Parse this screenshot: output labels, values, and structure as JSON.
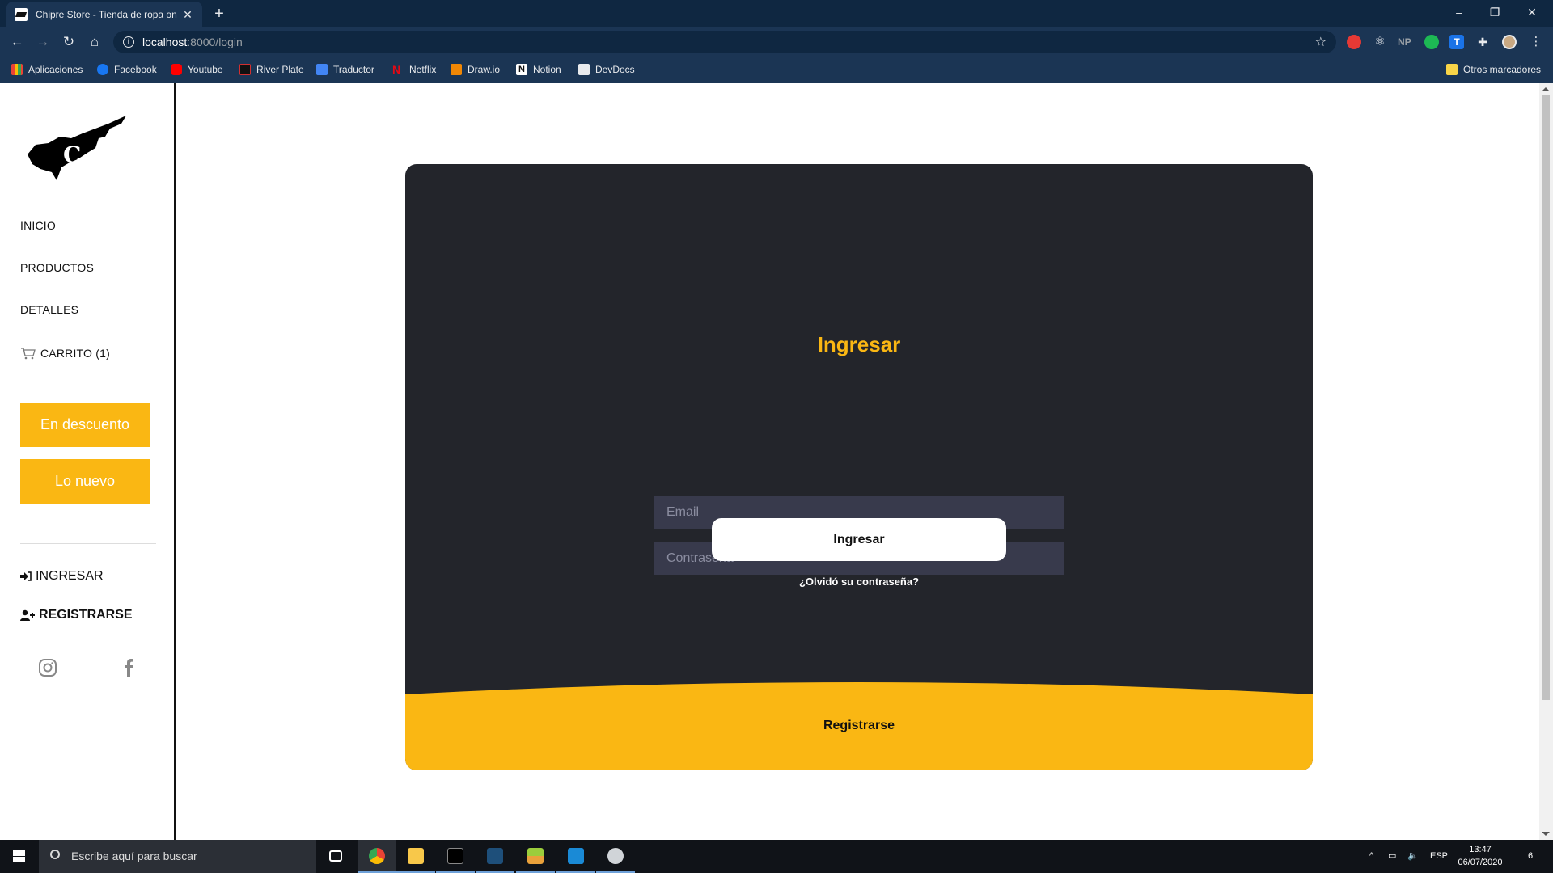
{
  "browser": {
    "tab_title": "Chipre Store - Tienda de ropa on",
    "url_host": "localhost",
    "url_path": ":8000/login",
    "bookmarks": [
      "Aplicaciones",
      "Facebook",
      "Youtube",
      "River Plate",
      "Traductor",
      "Netflix",
      "Draw.io",
      "Notion",
      "DevDocs"
    ],
    "other_bookmarks": "Otros marcadores"
  },
  "sidebar": {
    "nav": [
      "INICIO",
      "PRODUCTOS",
      "DETALLES"
    ],
    "cart_label": "CARRITO (1)",
    "promo_1": "En descuento",
    "promo_2": "Lo nuevo",
    "login_label": "INGRESAR",
    "register_label": "REGISTRARSE"
  },
  "login": {
    "title": "Ingresar",
    "email_placeholder": "Email",
    "password_placeholder": "Contraseña",
    "submit_label": "Ingresar",
    "forgot_label": "¿Olvidó su contraseña?",
    "register_label": "Registrarse"
  },
  "taskbar": {
    "search_placeholder": "Escribe aquí para buscar",
    "language": "ESP",
    "time": "13:47",
    "date": "06/07/2020",
    "notifications": "6"
  },
  "colors": {
    "accent": "#fab713",
    "card_bg": "#23252b",
    "input_bg": "#383a4c",
    "chrome_bg": "#0f2741"
  }
}
